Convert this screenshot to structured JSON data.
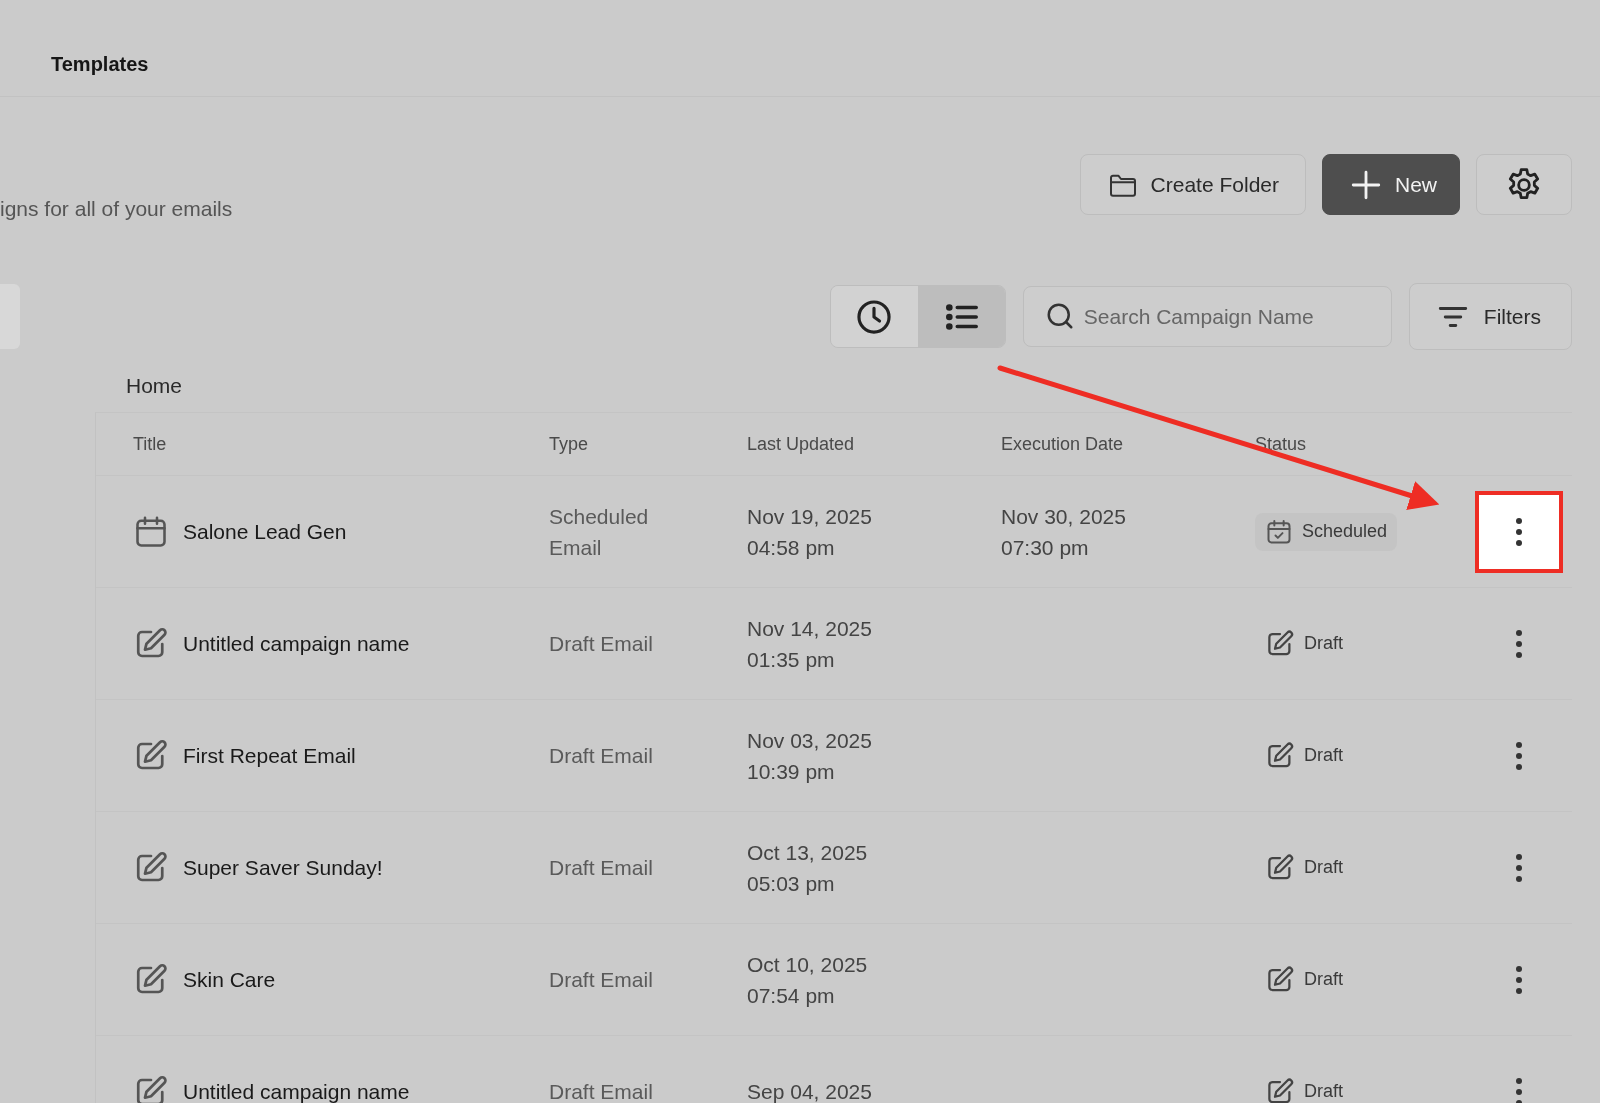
{
  "top_tab": {
    "label": "Templates"
  },
  "subtitle": "igns for all of your emails",
  "actions": {
    "create_folder": "Create Folder",
    "new": "New"
  },
  "toolbar": {
    "views": [
      {
        "kind": "recent",
        "selected": false
      },
      {
        "kind": "list",
        "selected": true
      }
    ],
    "search": {
      "placeholder": "Search Campaign Name"
    },
    "filters": "Filters"
  },
  "breadcrumb": "Home",
  "table": {
    "columns": [
      "Title",
      "Type",
      "Last Updated",
      "Execution Date",
      "Status"
    ],
    "rows": [
      {
        "kind": "scheduled",
        "title": "Salone Lead Gen",
        "type": [
          "Scheduled",
          "Email"
        ],
        "last_updated": [
          "Nov 19, 2025",
          "04:58 pm"
        ],
        "execution_date": [
          "Nov 30, 2025",
          "07:30 pm"
        ],
        "status": "Scheduled",
        "highlighted": true
      },
      {
        "kind": "draft",
        "title": "Untitled campaign name",
        "type": [
          "Draft Email"
        ],
        "last_updated": [
          "Nov 14, 2025",
          "01:35 pm"
        ],
        "status": "Draft",
        "highlighted": false
      },
      {
        "kind": "draft",
        "title": "First Repeat Email",
        "type": [
          "Draft Email"
        ],
        "last_updated": [
          "Nov 03, 2025",
          "10:39 pm"
        ],
        "status": "Draft",
        "highlighted": false
      },
      {
        "kind": "draft",
        "title": "Super Saver Sunday!",
        "type": [
          "Draft Email"
        ],
        "last_updated": [
          "Oct 13, 2025",
          "05:03 pm"
        ],
        "status": "Draft",
        "highlighted": false
      },
      {
        "kind": "draft",
        "title": "Skin Care",
        "type": [
          "Draft Email"
        ],
        "last_updated": [
          "Oct 10, 2025",
          "07:54 pm"
        ],
        "status": "Draft",
        "highlighted": false
      },
      {
        "kind": "draft",
        "title": "Untitled campaign name",
        "type": [
          "Draft Email"
        ],
        "last_updated": [
          "Sep 04, 2025"
        ],
        "status": "Draft",
        "highlighted": false
      }
    ]
  }
}
